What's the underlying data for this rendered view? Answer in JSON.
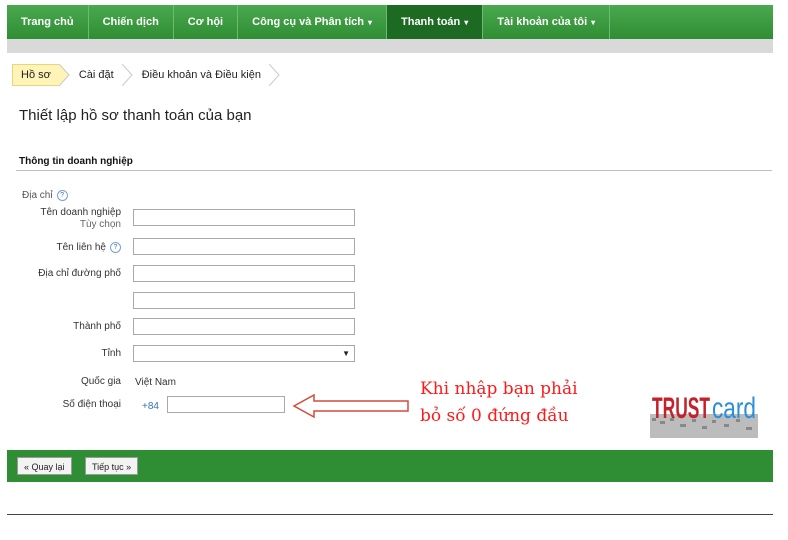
{
  "nav": {
    "items": [
      {
        "label": "Trang chủ",
        "caret": ""
      },
      {
        "label": "Chiến dịch",
        "caret": ""
      },
      {
        "label": "Cơ hội",
        "caret": ""
      },
      {
        "label": "Công cụ và Phân tích",
        "caret": "▾"
      },
      {
        "label": "Thanh toán",
        "caret": "▾",
        "active": true
      },
      {
        "label": "Tài khoản của tôi",
        "caret": "▾"
      }
    ]
  },
  "breadcrumb": [
    "Hồ sơ",
    "Cài đặt",
    "Điều khoản và Điều kiện"
  ],
  "page_title": "Thiết lập hồ sơ thanh toán của bạn",
  "section_header": "Thông tin doanh nghiệp",
  "address_label": "Địa chỉ",
  "help_glyph": "?",
  "fields": {
    "business_name": {
      "label": "Tên doanh nghiệp",
      "sublabel": "Tùy chọn",
      "value": ""
    },
    "contact_name": {
      "label": "Tên liên hệ",
      "value": ""
    },
    "street": {
      "label": "Địa chỉ đường phố",
      "value": ""
    },
    "street2": {
      "value": ""
    },
    "city": {
      "label": "Thành phố",
      "value": ""
    },
    "province": {
      "label": "Tỉnh",
      "value": ""
    },
    "country": {
      "label": "Quốc gia",
      "value": "Việt Nam"
    },
    "phone": {
      "label": "Số điện thoại",
      "prefix": "+84",
      "value": ""
    }
  },
  "annotation": {
    "line1": "Khi nhập bạn phải",
    "line2": "bỏ số 0 đứng đầu",
    "color": "#ff1a1a"
  },
  "logo": {
    "part1": "TRUST",
    "part2": "card"
  },
  "buttons": {
    "back": "« Quay lại",
    "next": "Tiếp tục »"
  },
  "colors": {
    "nav_green": "#2f8d34",
    "active_nav": "#1d6b22",
    "crumb_highlight": "#fff4b8"
  }
}
